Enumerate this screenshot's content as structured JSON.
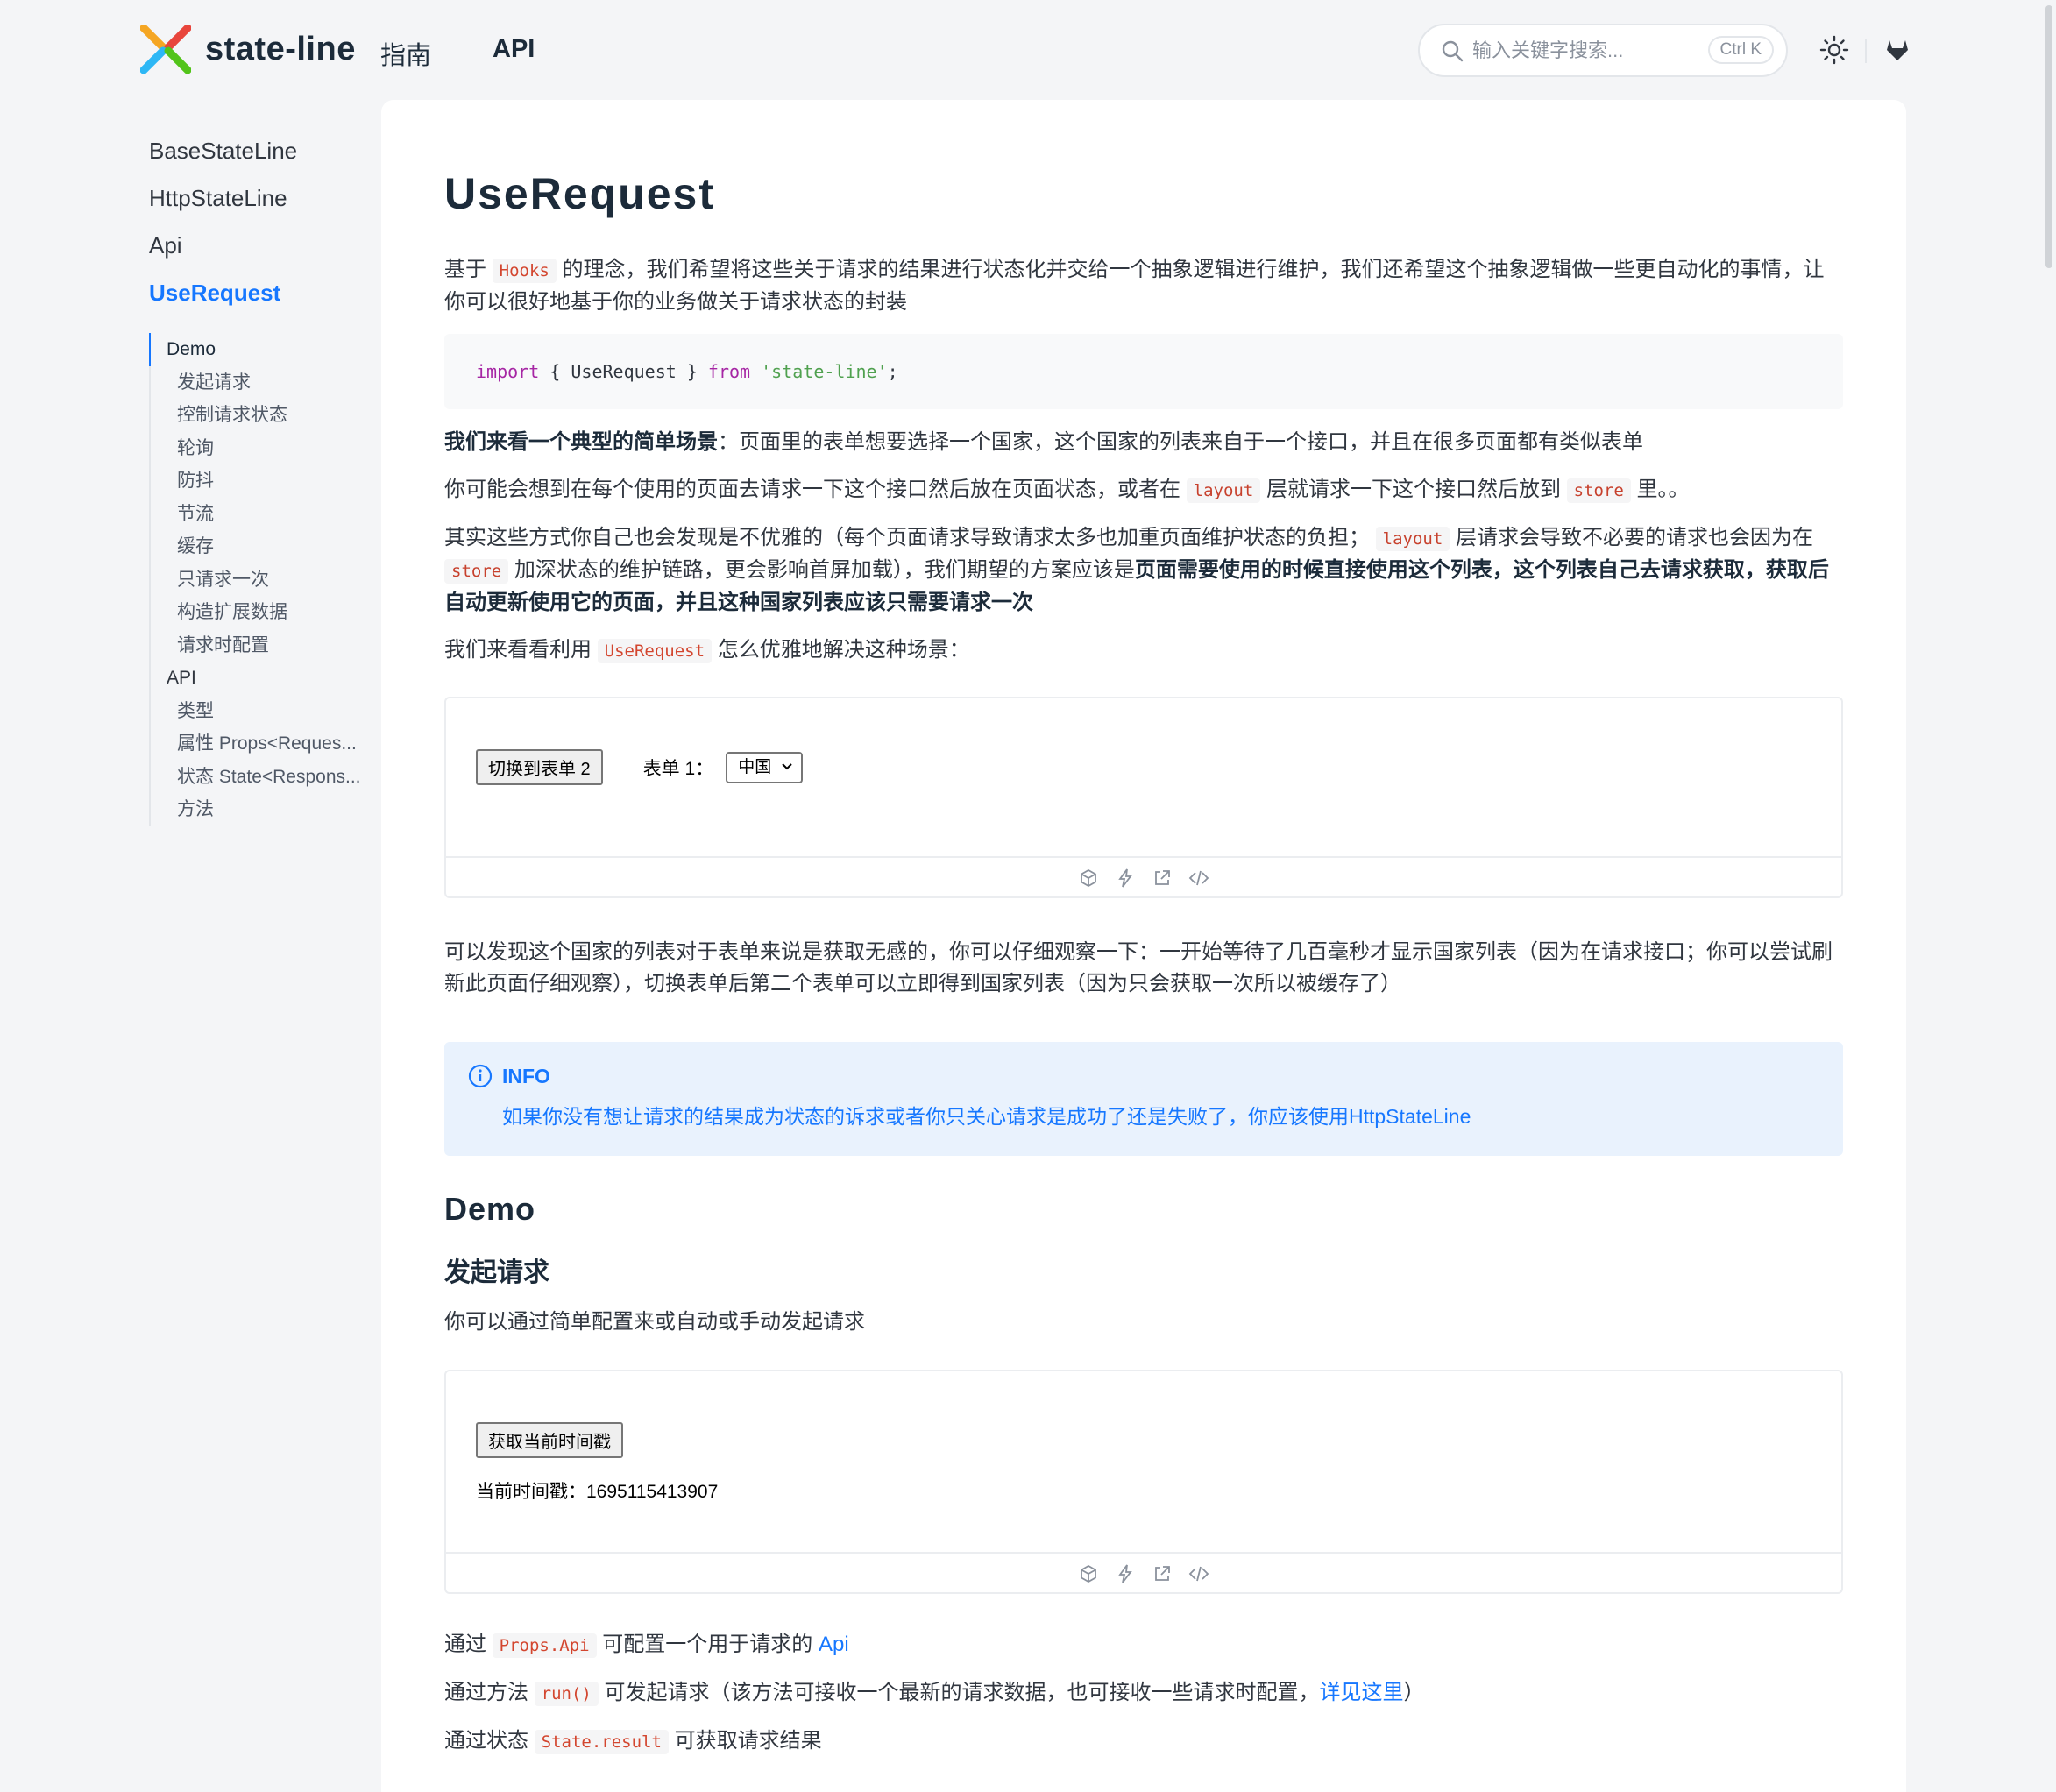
{
  "header": {
    "logo_text": "state-line",
    "nav": [
      "指南",
      "API"
    ],
    "search_placeholder": "输入关键字搜索...",
    "search_shortcut": "Ctrl K"
  },
  "sidebar": {
    "items": [
      "BaseStateLine",
      "HttpStateLine",
      "Api",
      "UseRequest"
    ],
    "toc": [
      {
        "label": "Demo",
        "level": 1
      },
      {
        "label": "发起请求",
        "level": 2
      },
      {
        "label": "控制请求状态",
        "level": 2
      },
      {
        "label": "轮询",
        "level": 2
      },
      {
        "label": "防抖",
        "level": 2
      },
      {
        "label": "节流",
        "level": 2
      },
      {
        "label": "缓存",
        "level": 2
      },
      {
        "label": "只请求一次",
        "level": 2
      },
      {
        "label": "构造扩展数据",
        "level": 2
      },
      {
        "label": "请求时配置",
        "level": 2
      },
      {
        "label": "API",
        "level": 1
      },
      {
        "label": "类型",
        "level": 2
      },
      {
        "label": "属性 Props<Reques...",
        "level": 2
      },
      {
        "label": "状态 State<Respons...",
        "level": 2
      },
      {
        "label": "方法",
        "level": 2
      }
    ]
  },
  "content": {
    "title": "UseRequest",
    "intro_a": "基于 ",
    "intro_code": "Hooks",
    "intro_b": " 的理念，我们希望将这些关于请求的结果进行状态化并交给一个抽象逻辑进行维护，我们还希望这个抽象逻辑做一些更自动化的事情，让你可以很好地基于你的业务做关于请求状态的封装",
    "code_import": "import",
    "code_mid": " { UseRequest } ",
    "code_from": "from",
    "code_str": "'state-line'",
    "code_end": ";",
    "scene_bold": "我们来看一个典型的简单场景",
    "scene_text": "：页面里的表单想要选择一个国家，这个国家的列表来自于一个接口，并且在很多页面都有类似表单",
    "p2_a": "你可能会想到在每个使用的页面去请求一下这个接口然后放在页面状态，或者在 ",
    "p2_code1": "layout",
    "p2_b": " 层就请求一下这个接口然后放到 ",
    "p2_code2": "store",
    "p2_c": " 里。。",
    "p3_a": "其实这些方式你自己也会发现是不优雅的（每个页面请求导致请求太多也加重页面维护状态的负担； ",
    "p3_code1": "layout",
    "p3_b": " 层请求会导致不必要的请求也会因为在 ",
    "p3_code2": "store",
    "p3_c": " 加深状态的维护链路，更会影响首屏加载），我们期望的方案应该是",
    "p3_bold": "页面需要使用的时候直接使用这个列表，这个列表自己去请求获取，获取后自动更新使用它的页面，并且这种国家列表应该只需要请求一次",
    "p4_a": "我们来看看利用 ",
    "p4_code": "UseRequest",
    "p4_b": " 怎么优雅地解决这种场景：",
    "demo1": {
      "button": "切换到表单 2",
      "label": "表单 1：",
      "select_value": "中国"
    },
    "p5": "可以发现这个国家的列表对于表单来说是获取无感的，你可以仔细观察一下：一开始等待了几百毫秒才显示国家列表（因为在请求接口；你可以尝试刷新此页面仔细观察），切换表单后第二个表单可以立即得到国家列表（因为只会获取一次所以被缓存了）",
    "info_title": "INFO",
    "info_text": "如果你没有想让请求的结果成为状态的诉求或者你只关心请求是成功了还是失败了，你应该使用",
    "info_link": "HttpStateLine",
    "h2_demo": "Demo",
    "h3_request": "发起请求",
    "p6": "你可以通过简单配置来或自动或手动发起请求",
    "demo2": {
      "button": "获取当前时间戳",
      "label": "当前时间戳：",
      "value": "1695115413907"
    },
    "p7_a": "通过 ",
    "p7_code": "Props.Api",
    "p7_b": " 可配置一个用于请求的 ",
    "p7_link": "Api",
    "p8_a": "通过方法 ",
    "p8_code": "run()",
    "p8_b": " 可发起请求（该方法可接收一个最新的请求数据，也可接收一些请求时配置，",
    "p8_link": "详见这里",
    "p8_c": "）",
    "p9_a": "通过状态 ",
    "p9_code": "State.result",
    "p9_b": " 可获取请求结果"
  },
  "colors": {
    "accent": "#1677ff",
    "inline_code": "#d3462f",
    "info_bg": "#e9f2fd"
  }
}
